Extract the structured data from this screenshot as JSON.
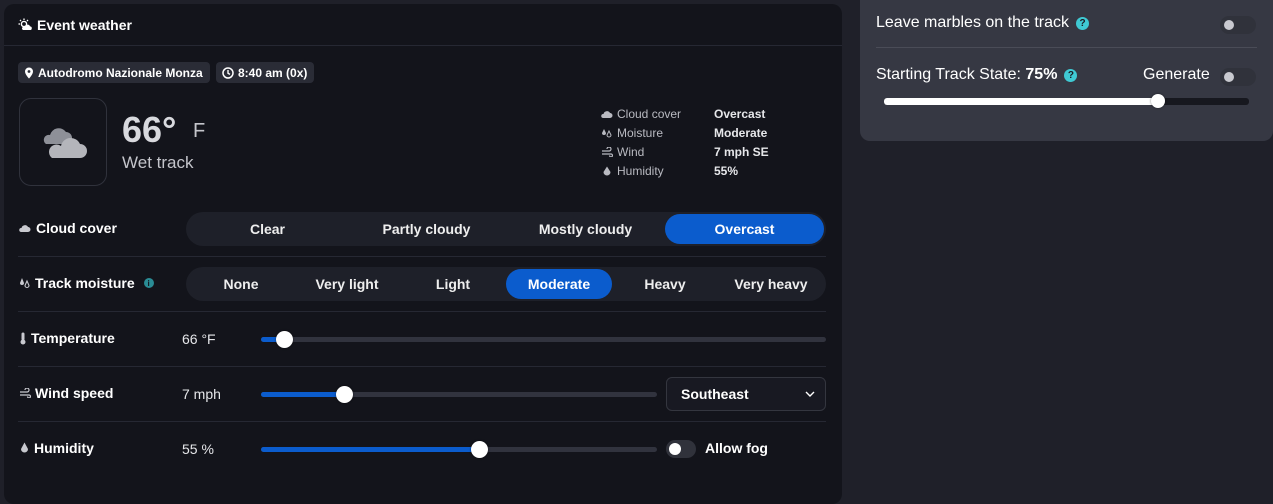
{
  "header": {
    "title": "Event weather"
  },
  "location": {
    "track": "Autodromo Nazionale Monza",
    "time": "8:40 am (0x)"
  },
  "current": {
    "temperature": "66°",
    "unit": "F",
    "condition": "Wet track"
  },
  "stats": [
    {
      "label": "Cloud cover",
      "value": "Overcast"
    },
    {
      "label": "Moisture",
      "value": "Moderate"
    },
    {
      "label": "Wind",
      "value": "7 mph SE"
    },
    {
      "label": "Humidity",
      "value": "55%"
    }
  ],
  "cloud_cover": {
    "label": "Cloud cover",
    "options": [
      "Clear",
      "Partly cloudy",
      "Mostly cloudy",
      "Overcast"
    ],
    "selected": 3
  },
  "track_moisture": {
    "label": "Track moisture",
    "info_icon": "i",
    "options": [
      "None",
      "Very light",
      "Light",
      "Moderate",
      "Heavy",
      "Very heavy"
    ],
    "selected": 3
  },
  "temperature": {
    "label": "Temperature",
    "value_text": "66 °F",
    "level": 0.04
  },
  "wind_speed": {
    "label": "Wind speed",
    "value_text": "7 mph",
    "level": 0.21,
    "direction": "Southeast"
  },
  "humidity": {
    "label": "Humidity",
    "value_text": "55 %",
    "level": 0.55,
    "allow_fog_label": "Allow fog",
    "allow_fog": false
  },
  "side": {
    "marbles_label": "Leave marbles on the track",
    "marbles_on": false,
    "starting_state_label": "Starting Track State: ",
    "starting_state_value": "75%",
    "starting_state_level": 0.75,
    "generate_label": "Generate",
    "generate_on": false,
    "help_icon": "?"
  },
  "colors": {
    "accent": "#0b5ccd",
    "panel": "#13141b",
    "background": "#1f2029",
    "side_panel": "#363843",
    "help": "#3fc9d3"
  }
}
